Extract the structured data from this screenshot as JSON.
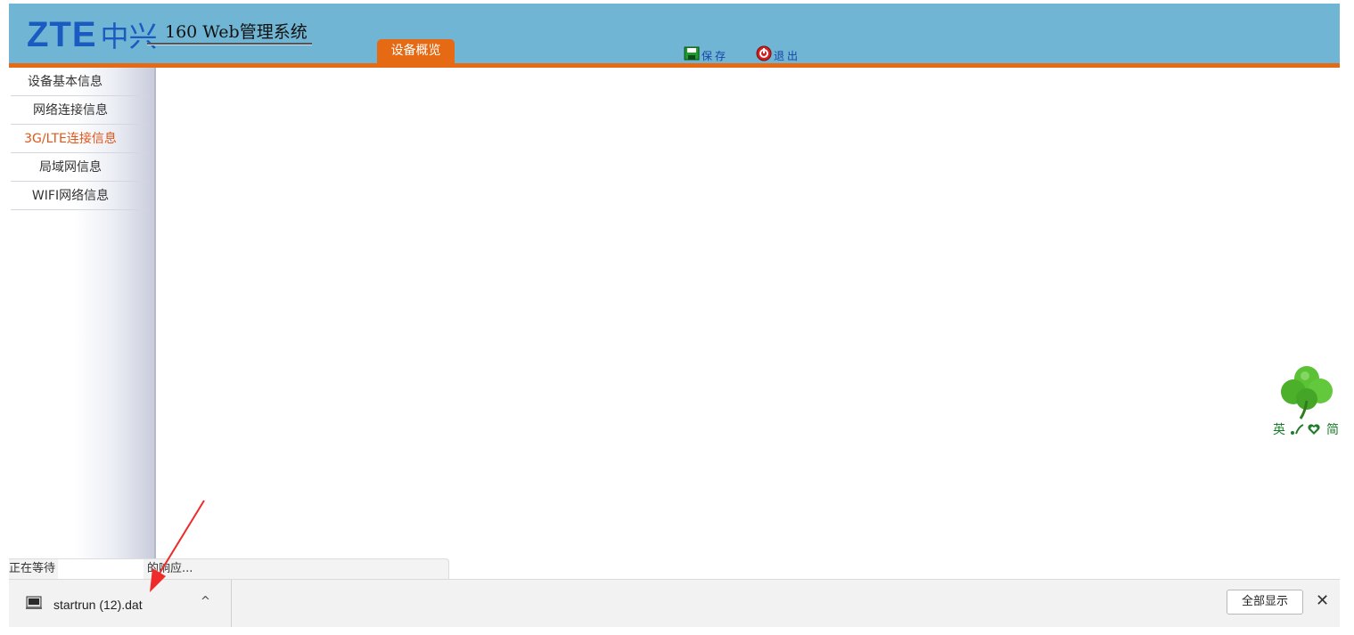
{
  "header": {
    "logo_latin": "ZTE",
    "logo_cn": "中兴",
    "system_title": "160 Web管理系统",
    "tab_overview": "设备概览",
    "save_label": "保存",
    "exit_label": "退出"
  },
  "sidebar": {
    "items": [
      {
        "label": "设备基本信息"
      },
      {
        "label": "网络连接信息"
      },
      {
        "label": "3G/LTE连接信息",
        "active": true
      },
      {
        "label": "局域网信息"
      },
      {
        "label": "WIFI网络信息"
      }
    ]
  },
  "lang_widget": {
    "left": "英",
    "right": "简",
    "icons": [
      "clover-icon",
      "heart-icon"
    ]
  },
  "status": {
    "prefix": "正在等待",
    "suffix": "的响应..."
  },
  "download": {
    "filename": "startrun (12).dat",
    "show_all": "全部显示",
    "close_glyph": "✕",
    "chevron_glyph": "^"
  },
  "colors": {
    "header_bg": "#70b5d3",
    "accent_orange": "#e66a14",
    "logo_blue": "#1a5bc2",
    "active_item": "#e0561b",
    "annotation_red": "#ee2a2a"
  }
}
